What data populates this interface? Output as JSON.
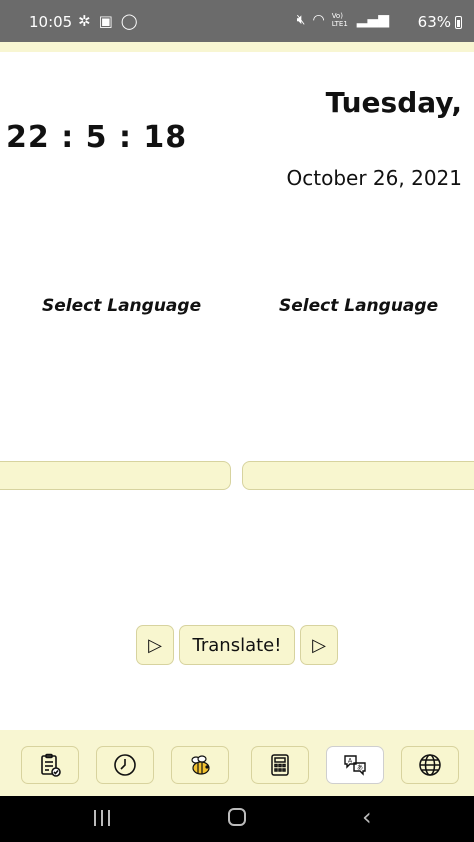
{
  "status_bar": {
    "time": "10:05",
    "left_icons": [
      "pinwheel-icon",
      "image-icon",
      "whatsapp-icon"
    ],
    "right_icons": [
      "mute-icon",
      "wifi-icon",
      "volte-lte-icon",
      "signal-icon"
    ],
    "volte_label": "Vo) LTE1",
    "battery": "63%"
  },
  "header": {
    "day": "Tuesday,",
    "clock": "22 : 5 : 18",
    "date": "October 26, 2021"
  },
  "translator": {
    "source_language": "Select Language",
    "target_language": "Select Language",
    "source_text": "",
    "target_text": "",
    "play_left": "▷",
    "translate_label": "Translate!",
    "play_right": "▷"
  },
  "bottom_nav": {
    "items": [
      {
        "icon": "clipboard-icon"
      },
      {
        "icon": "clock-icon"
      },
      {
        "icon": "bee-icon"
      },
      {
        "icon": "calculator-icon"
      },
      {
        "icon": "translate-icon",
        "active": true
      },
      {
        "icon": "globe-icon"
      }
    ]
  },
  "colors": {
    "status_bar": "#6b6b6b",
    "accent_yellow": "#f8f6cf",
    "accent_border": "#d7d39f",
    "system_nav": "#000000"
  }
}
